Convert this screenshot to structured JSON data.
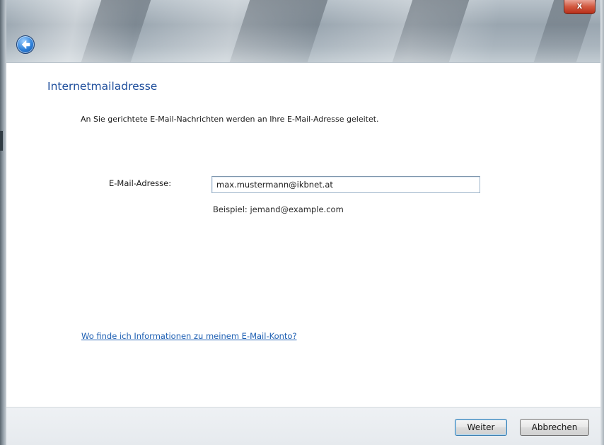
{
  "window": {
    "close_glyph": "x",
    "back_icon": "back-arrow-icon"
  },
  "main": {
    "title": "Internetmailadresse",
    "intro": "An Sie gerichtete E-Mail-Nachrichten werden an Ihre E-Mail-Adresse geleitet.",
    "email_label": "E-Mail-Adresse:",
    "email_value": "max.mustermann@ikbnet.at",
    "example": "Beispiel: jemand@example.com",
    "help_link": "Wo finde ich Informationen zu meinem E-Mail-Konto?"
  },
  "footer": {
    "next_label": "Weiter",
    "cancel_label": "Abbrechen"
  },
  "colors": {
    "title": "#1e4e9c",
    "link": "#1d5fb3",
    "close": "#c0392b"
  }
}
